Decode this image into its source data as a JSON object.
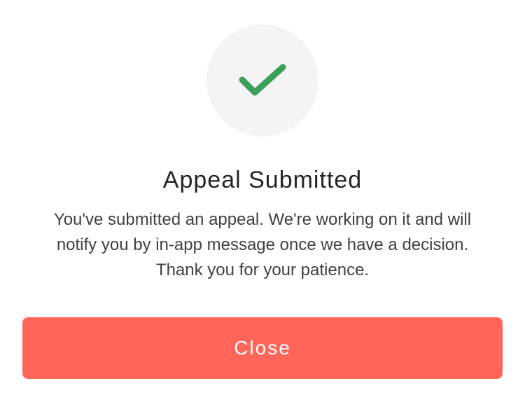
{
  "dialog": {
    "icon": "checkmark-icon",
    "icon_color": "#3c9f5a",
    "icon_background": "#f4f4f4",
    "title": "Appeal Submitted",
    "message": "You've submitted an appeal. We're working on it and will notify you by in-app message once we have a decision. Thank you for your patience.",
    "close_label": "Close",
    "button_color": "#ff6659"
  }
}
